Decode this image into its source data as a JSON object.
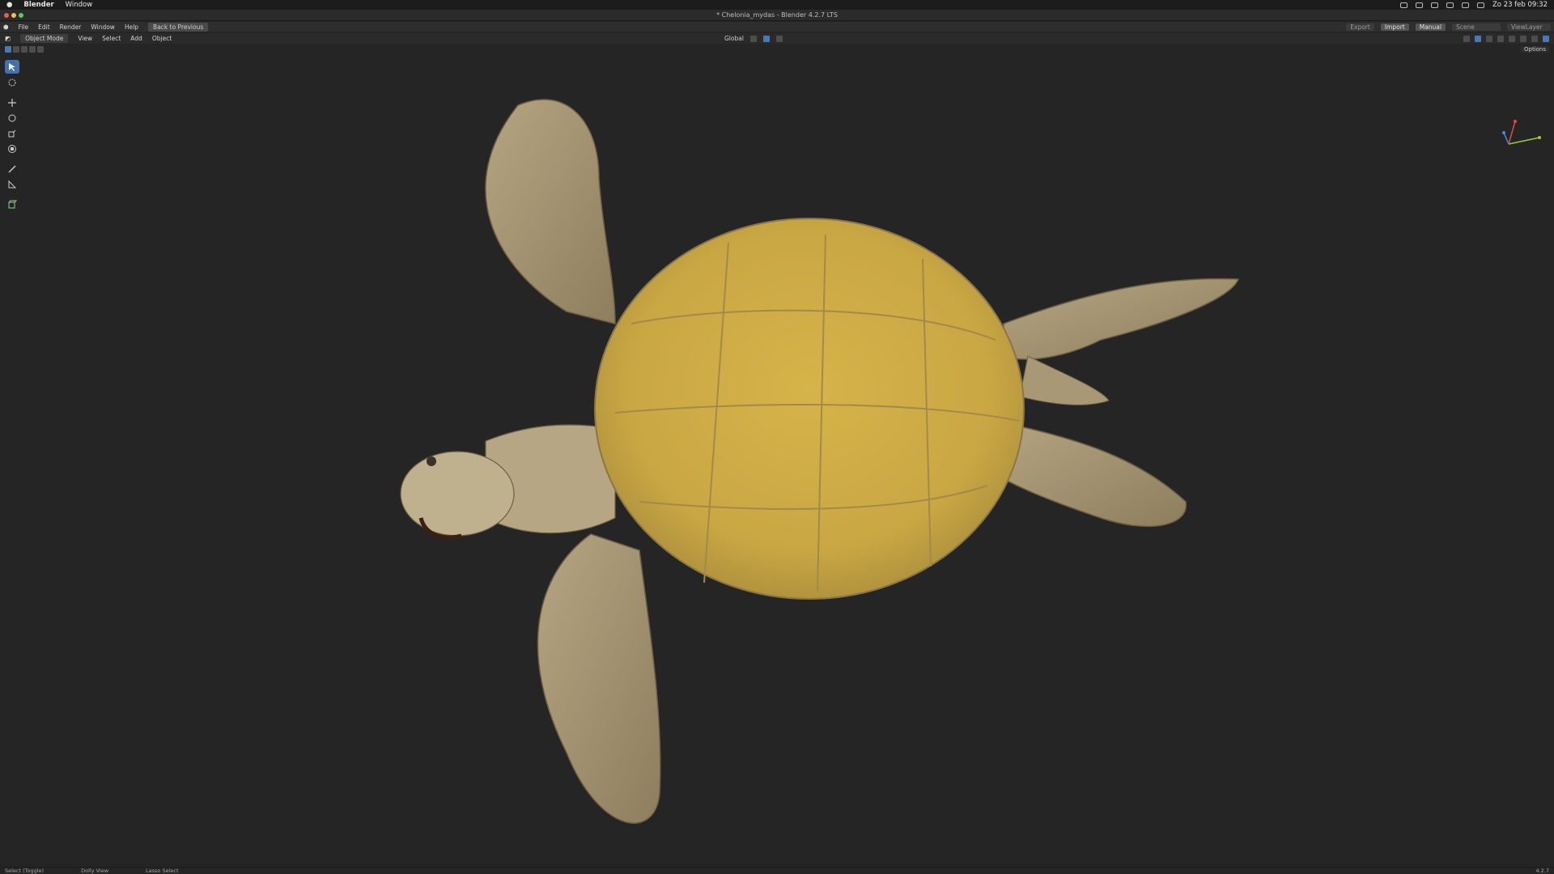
{
  "macbar": {
    "app_name": "Blender",
    "menu_window": "Window",
    "datetime": "Zo 23 feb 09:32"
  },
  "titlebar": {
    "title": "* Chelonia_mydas - Blender 4.2.7 LTS"
  },
  "topmenu": {
    "items": [
      "File",
      "Edit",
      "Render",
      "Window",
      "Help"
    ],
    "back_button": "Back to Previous",
    "export": "Export",
    "import": "Import",
    "manual": "Manual",
    "scene": "Scene",
    "view_layer": "ViewLayer"
  },
  "viewport_header": {
    "mode": "Object Mode",
    "menus": [
      "View",
      "Select",
      "Add",
      "Object"
    ],
    "orientation": "Global",
    "options": "Options"
  },
  "statusbar": {
    "select": "Select (Toggle)",
    "dolly": "Dolly View",
    "lasso": "Lasso Select",
    "version": "4.2.7"
  },
  "colors": {
    "accent": "#4671a8",
    "background": "#252525",
    "shell": "#d9c79a",
    "scute": "#c9a743"
  },
  "icons": [
    "select-box-icon",
    "cursor-icon",
    "move-icon",
    "rotate-icon",
    "scale-icon",
    "transform-icon",
    "annotate-icon",
    "measure-icon",
    "add-cube-icon"
  ]
}
